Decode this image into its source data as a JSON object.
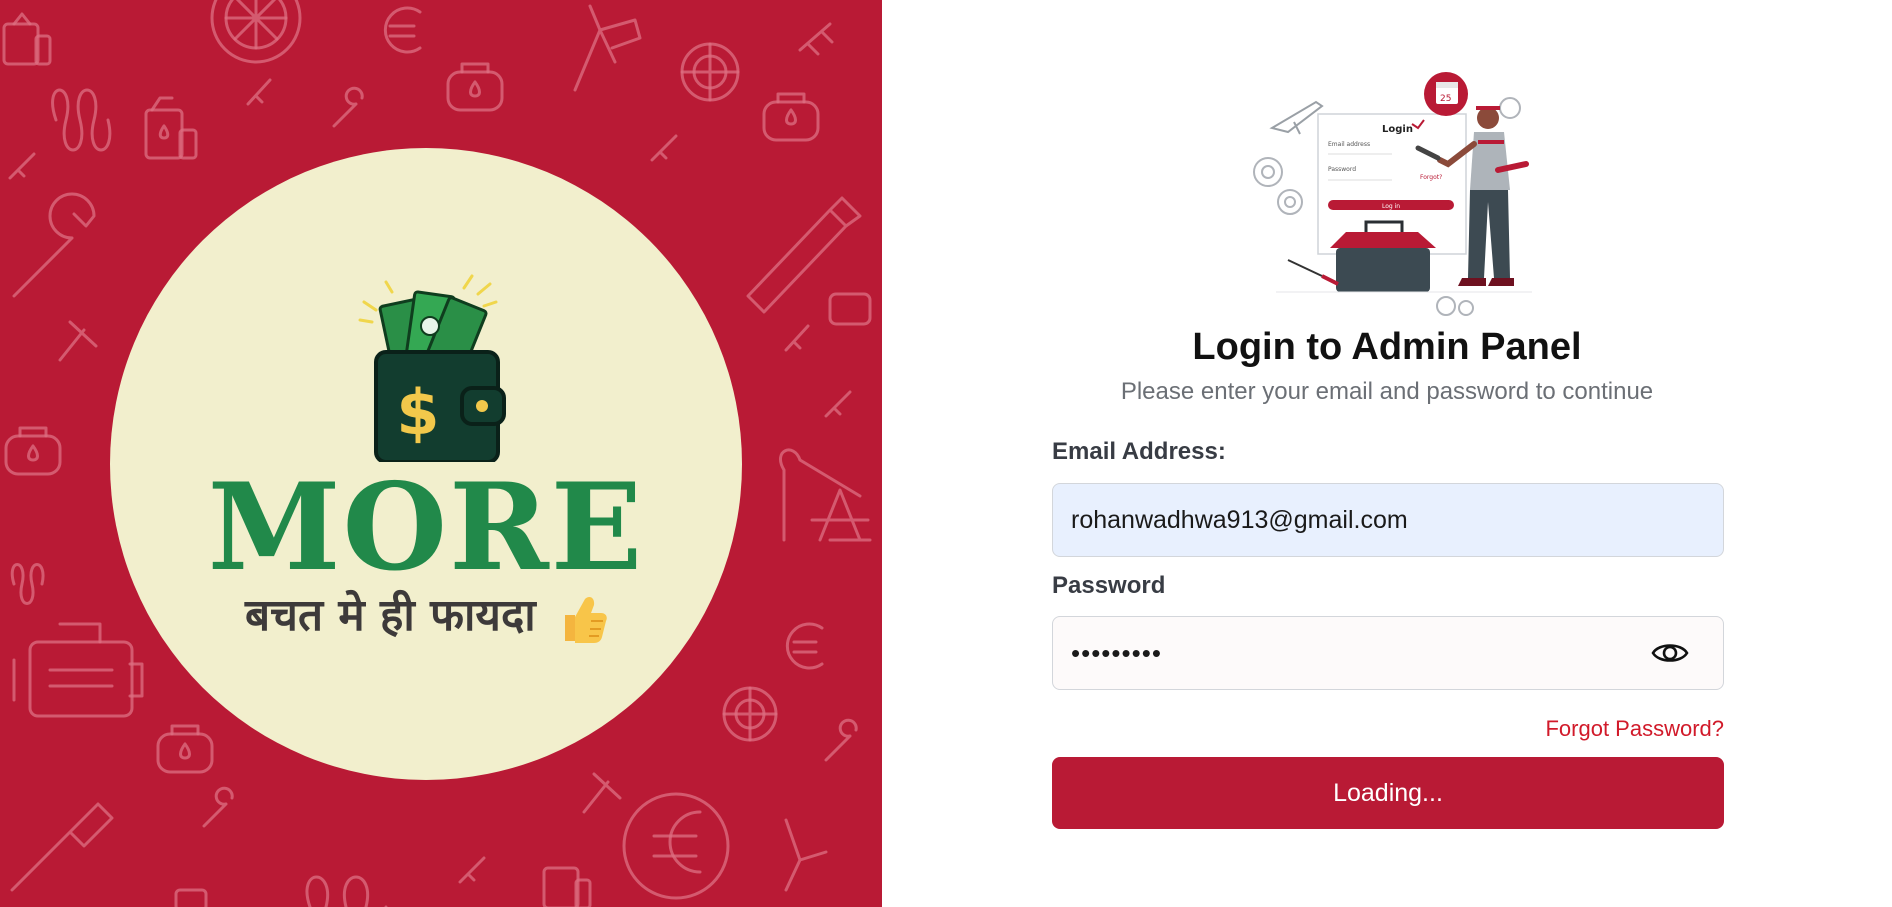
{
  "brand": {
    "logo_text": "MORE",
    "tagline": "बचत मे ही फायदा",
    "background_color": "#b91a35",
    "circle_color": "#f2efcd",
    "logo_color": "#21894a",
    "icons": [
      "wallet-icon",
      "dollar-icon",
      "thumbs-up-icon",
      "wrench-icon",
      "spark-plug-icon",
      "oil-can-icon",
      "gear-icon",
      "engine-icon",
      "caliper-icon",
      "hammer-icon",
      "oil-pump-icon",
      "wheel-icon",
      "spring-icon"
    ]
  },
  "illustration": {
    "login_label": "Login",
    "email_caption": "Email address",
    "password_caption": "Password",
    "forgot_caption": "Forgot?",
    "button_caption": "Log in",
    "calendar_day": "25"
  },
  "login": {
    "title": "Login to Admin Panel",
    "subtitle": "Please enter your email and password to continue",
    "email_label": "Email Address:",
    "email_value": "rohanwadhwa913@gmail.com",
    "password_label": "Password",
    "password_value": "•••••••••",
    "forgot_password": "Forgot Password?",
    "submit_label": "Loading...",
    "accent_color": "#b91a35",
    "link_color": "#d11a2a"
  }
}
